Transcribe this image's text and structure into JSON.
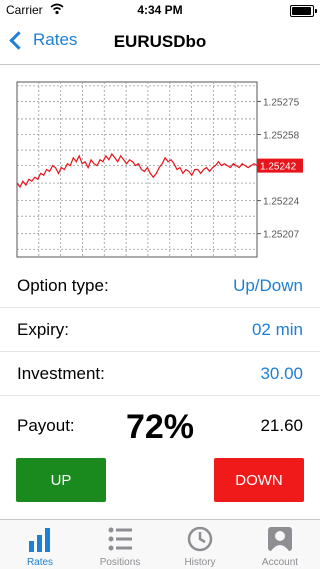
{
  "status": {
    "carrier": "Carrier",
    "time": "4:34 PM"
  },
  "nav": {
    "back_label": "Rates",
    "title": "EURUSDbo"
  },
  "chart": {
    "y_ticks": [
      "1.25275",
      "1.25258",
      "1.25242",
      "1.25224",
      "1.25207"
    ],
    "current_value": "1.25242",
    "line_color": "#e8141c",
    "grid_color": "#9a9a9a"
  },
  "chart_data": {
    "type": "line",
    "y_ticks": [
      1.25275,
      1.25258,
      1.25242,
      1.25224,
      1.25207
    ],
    "ylim": [
      1.25195,
      1.25285
    ],
    "current": 1.25242,
    "values": [
      1.25233,
      1.25231,
      1.25234,
      1.25232,
      1.25235,
      1.25234,
      1.25236,
      1.25235,
      1.25238,
      1.25237,
      1.2524,
      1.25239,
      1.25242,
      1.25241,
      1.25238,
      1.25241,
      1.2524,
      1.25243,
      1.25242,
      1.25246,
      1.25244,
      1.25247,
      1.25243,
      1.25244,
      1.25241,
      1.25245,
      1.25243,
      1.25242,
      1.25245,
      1.25244,
      1.25247,
      1.25245,
      1.25248,
      1.25246,
      1.25244,
      1.25247,
      1.25245,
      1.25243,
      1.25245,
      1.25244,
      1.25242,
      1.25243,
      1.2524,
      1.25239,
      1.25241,
      1.25238,
      1.25236,
      1.25238,
      1.25241,
      1.25243,
      1.25246,
      1.25244,
      1.25245,
      1.25243,
      1.2524,
      1.25241,
      1.25238,
      1.2524,
      1.25239,
      1.25237,
      1.2524,
      1.2524,
      1.25238,
      1.2524,
      1.25241,
      1.25239,
      1.25241,
      1.25242,
      1.25244,
      1.25242,
      1.25243,
      1.25242,
      1.25241,
      1.25243,
      1.25242,
      1.25241,
      1.25243,
      1.25242,
      1.25241,
      1.25242,
      1.25243,
      1.25242
    ]
  },
  "rows": {
    "option_type": {
      "label": "Option type:",
      "value": "Up/Down"
    },
    "expiry": {
      "label": "Expiry:",
      "value": "02 min"
    },
    "investment": {
      "label": "Investment:",
      "value": "30.00"
    },
    "payout": {
      "label": "Payout:",
      "percent": "72%",
      "amount": "21.60"
    }
  },
  "buttons": {
    "up": "UP",
    "down": "DOWN"
  },
  "colors": {
    "accent": "#1e7fd6",
    "up": "#1a8a1e",
    "down": "#f11a1a"
  },
  "tabs": [
    {
      "label": "Rates",
      "icon": "bar-chart-icon"
    },
    {
      "label": "Positions",
      "icon": "list-icon"
    },
    {
      "label": "History",
      "icon": "clock-icon"
    },
    {
      "label": "Account",
      "icon": "person-icon"
    }
  ]
}
